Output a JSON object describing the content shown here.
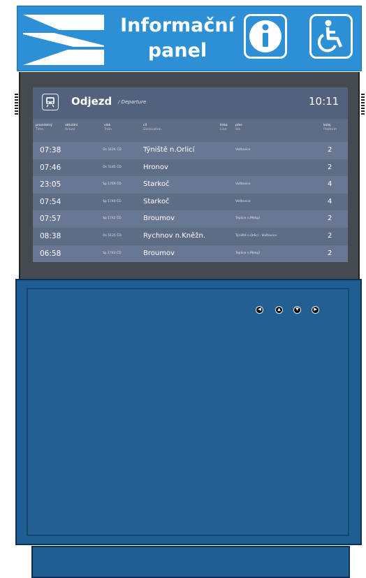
{
  "header": {
    "title_line1": "Informační",
    "title_line2": "panel",
    "logo_icon": "railway-logo-icon",
    "info_icon": "info-icon",
    "access_icon": "wheelchair-icon",
    "color": "#2d8fd6"
  },
  "board": {
    "heading": "Odjezd",
    "heading_en": "/ Departure",
    "time": "10:11",
    "icon": "train-icon",
    "columns": [
      {
        "label": "pravidelný",
        "sub": "Time"
      },
      {
        "label": "aktuální",
        "sub": "Actual"
      },
      {
        "label": "vlak",
        "sub": "Train"
      },
      {
        "label": "cíl",
        "sub": "Destination"
      },
      {
        "label": "linka",
        "sub": "Line"
      },
      {
        "label": "přes",
        "sub": "Via"
      },
      {
        "label": "kolej",
        "sub": "Platform"
      }
    ],
    "rows": [
      {
        "time": "07:38",
        "train": "Os 5124 ČD",
        "destination": "Týniště n.Orlicí",
        "via": "Voštovice",
        "track": "2"
      },
      {
        "time": "07:46",
        "train": "Os 5145 ČD",
        "destination": "Hronov",
        "via": "",
        "track": "2"
      },
      {
        "time": "23:05",
        "train": "Sp 1769 ČD",
        "destination": "Starkoč",
        "via": "Voštovice",
        "track": "4"
      },
      {
        "time": "07:54",
        "train": "Sp 1740 ČD",
        "destination": "Starkoč",
        "via": "Voštovice",
        "track": "4"
      },
      {
        "time": "07:57",
        "train": "Sp 1742 ČD",
        "destination": "Broumov",
        "via": "Teplice n.Metují",
        "track": "2"
      },
      {
        "time": "08:38",
        "train": "Os 5125 ČD",
        "destination": "Rychnov n.Kněžn.",
        "via": "Týniště n.Orlicí - Voštovice",
        "track": "2"
      },
      {
        "time": "06:58",
        "train": "Sp 1743 ČD",
        "destination": "Broumov",
        "via": "Teplice n.Metují",
        "track": "2"
      }
    ]
  },
  "cabinet": {
    "buttons": [
      {
        "name": "left-arrow-button",
        "glyph": "◀"
      },
      {
        "name": "up-arrow-button",
        "glyph": "▲"
      },
      {
        "name": "down-arrow-button",
        "glyph": "▼"
      },
      {
        "name": "right-arrow-button",
        "glyph": "▶"
      }
    ],
    "color": "#1f5e92"
  }
}
